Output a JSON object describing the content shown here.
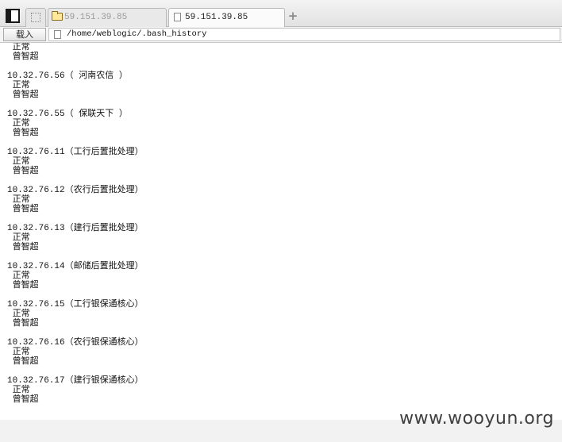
{
  "tabs": [
    {
      "label": "59.151.39.85",
      "icon": "folder-icon",
      "active": false
    },
    {
      "label": "59.151.39.85",
      "icon": "file-icon",
      "active": true
    }
  ],
  "toolbar": {
    "load_label": "载入",
    "address": "/home/weblogic/.bash_history"
  },
  "content_lines": [
    " 正常",
    " 曾智超",
    "",
    "10.32.76.56（ 河南农信 ）",
    " 正常",
    " 曾智超",
    "",
    "10.32.76.55（ 保联天下 ）",
    " 正常",
    " 曾智超",
    "",
    "10.32.76.11（工行后置批处理）",
    " 正常",
    " 曾智超",
    "",
    "10.32.76.12（农行后置批处理）",
    " 正常",
    " 曾智超",
    "",
    "10.32.76.13（建行后置批处理）",
    " 正常",
    " 曾智超",
    "",
    "10.32.76.14（邮储后置批处理）",
    " 正常",
    " 曾智超",
    "",
    "10.32.76.15（工行银保通核心）",
    " 正常",
    " 曾智超",
    "",
    "10.32.76.16（农行银保通核心）",
    " 正常",
    " 曾智超",
    "",
    "10.32.76.17（建行银保通核心）",
    " 正常",
    " 曾智超"
  ],
  "watermark": "www.wooyun.org"
}
